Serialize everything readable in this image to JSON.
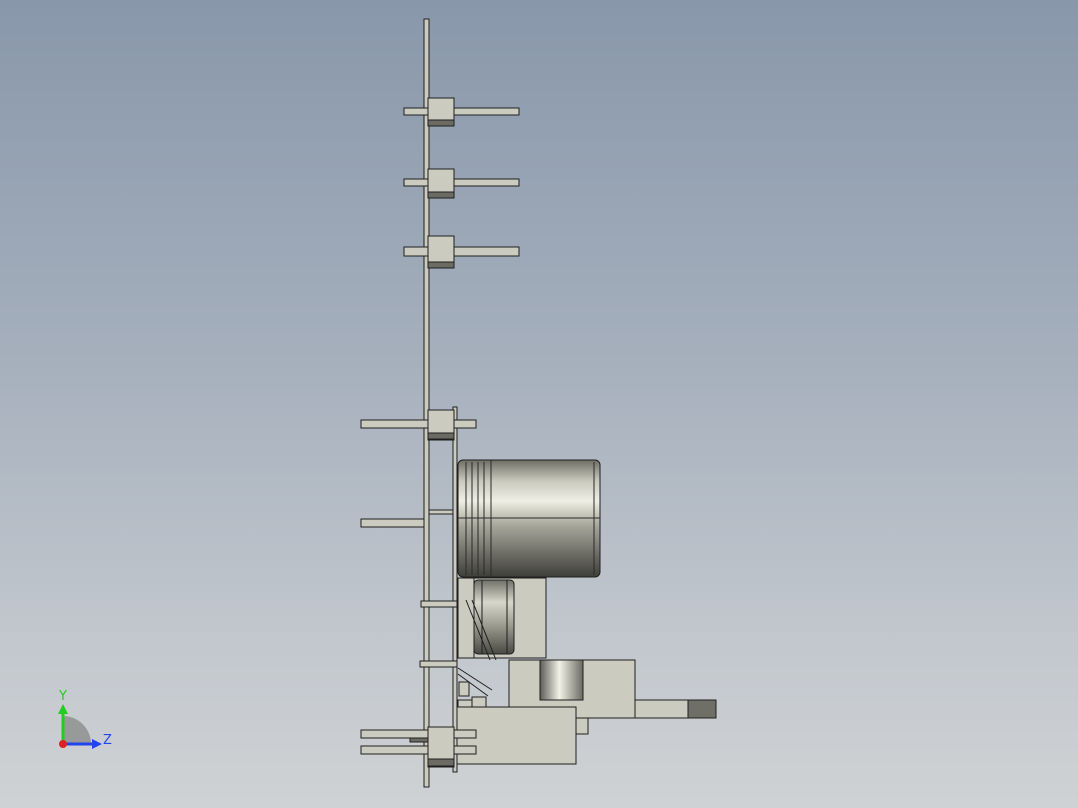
{
  "view": {
    "triad": {
      "y_label": "Y",
      "z_label": "Z",
      "colors": {
        "y_axis": "#22cc22",
        "z_axis": "#2244ee",
        "x_axis": "#dd2222"
      }
    },
    "colors": {
      "part_fill": "#cbcbbf",
      "part_shadow": "#6b6b63",
      "edge": "#1f1f1f"
    }
  }
}
